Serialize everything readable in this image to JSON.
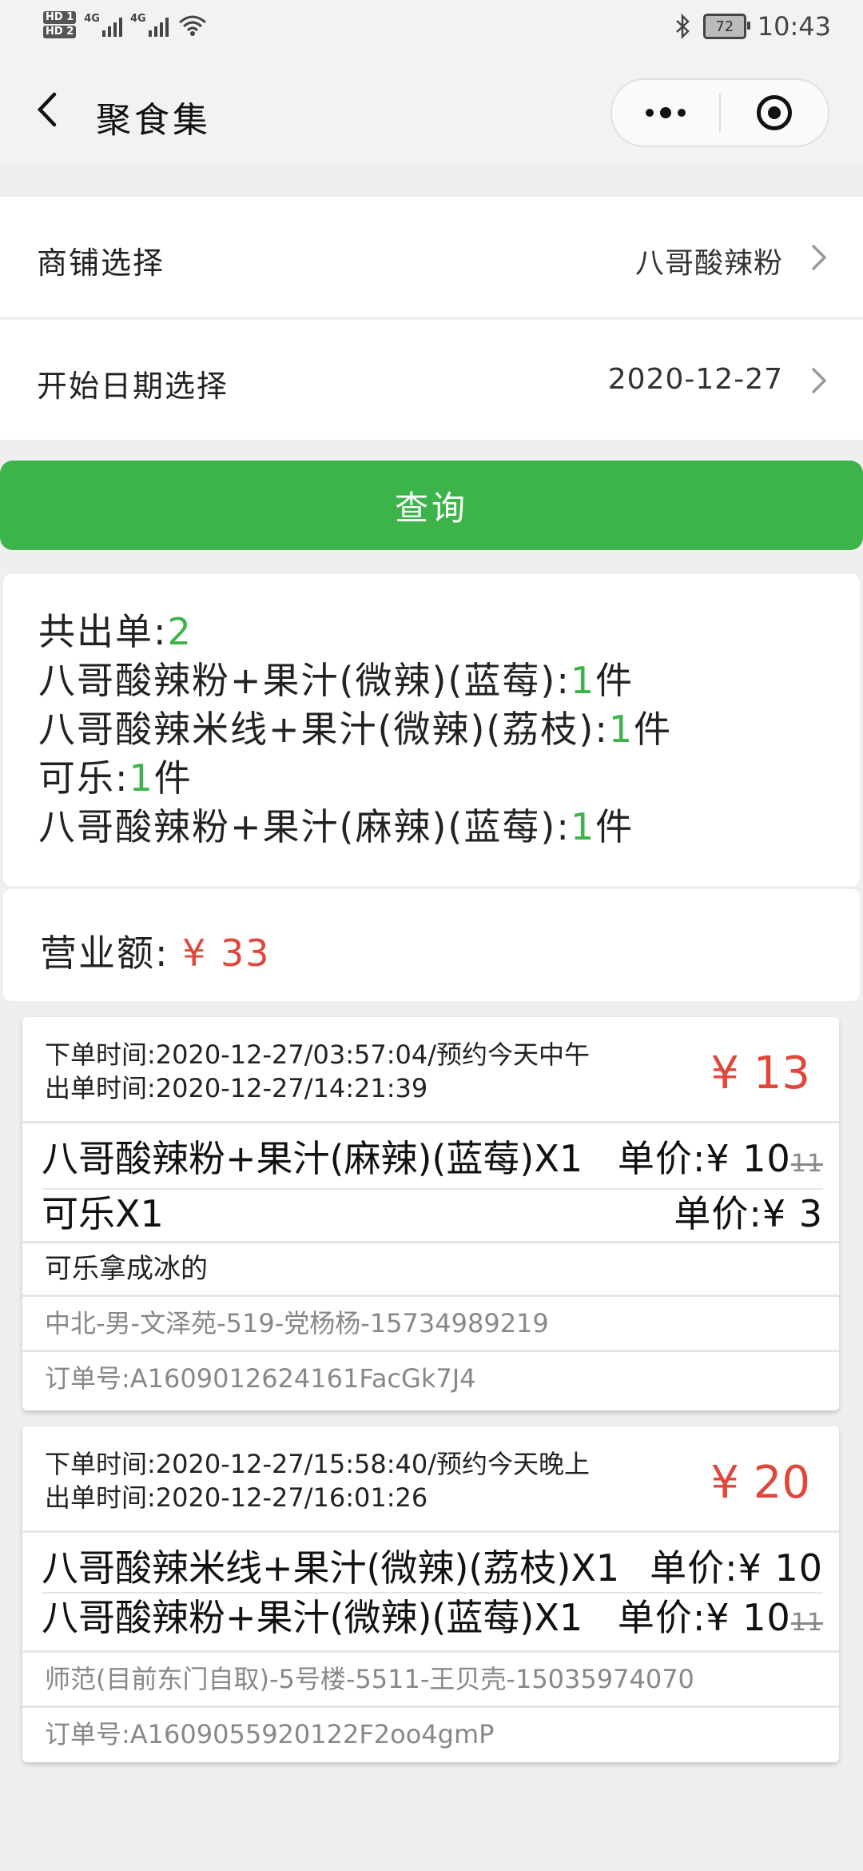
{
  "status_bar": {
    "sim1": "HD 1",
    "sim2": "HD 2",
    "net1": "4G",
    "net2": "4G",
    "battery": "72",
    "time": "10:43"
  },
  "nav": {
    "title": "聚食集"
  },
  "shop_select": {
    "label": "商铺选择",
    "value": "八哥酸辣粉"
  },
  "date_select": {
    "label": "开始日期选择",
    "value": "2020-12-27"
  },
  "query_button": "查询",
  "summary": {
    "total_label": "共出单:",
    "total_count": "2",
    "items": [
      {
        "name": "八哥酸辣粉+果汁(微辣)(蓝莓):",
        "qty": "1",
        "unit": "件"
      },
      {
        "name": "八哥酸辣米线+果汁(微辣)(荔枝):",
        "qty": "1",
        "unit": "件"
      },
      {
        "name": "可乐:",
        "qty": "1",
        "unit": "件"
      },
      {
        "name": "八哥酸辣粉+果汁(麻辣)(蓝莓):",
        "qty": "1",
        "unit": "件"
      }
    ],
    "revenue_label": "营业额: ",
    "revenue_value": "¥ 33"
  },
  "orders": [
    {
      "order_time": "下单时间:2020-12-27/03:57:04/预约今天中午",
      "out_time": "出单时间:2020-12-27/14:21:39",
      "total": "¥ 13",
      "items": [
        {
          "name": "八哥酸辣粉+果汁(麻辣)(蓝莓)X1",
          "price": "单价:¥ 10",
          "old_price": "11"
        },
        {
          "name": "可乐X1",
          "price": "单价:¥ 3",
          "old_price": ""
        }
      ],
      "note": "可乐拿成冰的",
      "address": "中北-男-文泽苑-519-党杨杨-15734989219",
      "order_no": "订单号:A1609012624161FacGk7J4"
    },
    {
      "order_time": "下单时间:2020-12-27/15:58:40/预约今天晚上",
      "out_time": "出单时间:2020-12-27/16:01:26",
      "total": "¥ 20",
      "items": [
        {
          "name": "八哥酸辣米线+果汁(微辣)(荔枝)X1",
          "price": "单价:¥ 10",
          "old_price": ""
        },
        {
          "name": "八哥酸辣粉+果汁(微辣)(蓝莓)X1",
          "price": "单价:¥ 10",
          "old_price": "11"
        }
      ],
      "address": "师范(目前东门自取)-5号楼-5511-王贝壳-15035974070",
      "order_no": "订单号:A1609055920122F2oo4gmP"
    }
  ],
  "colors": {
    "accent_green": "#3db44a",
    "price_red": "#e0473b"
  }
}
